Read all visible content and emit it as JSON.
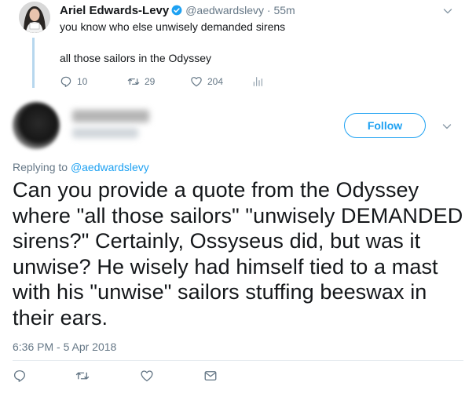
{
  "parent_tweet": {
    "author_name": "Ariel Edwards-Levy",
    "handle_time": "@aedwardslevy · 55m",
    "line1": "you know who else unwisely demanded sirens",
    "line2": "all those sailors in the Odyssey",
    "replies": "10",
    "retweets": "29",
    "likes": "204",
    "icons": [
      "reply-icon",
      "retweet-icon",
      "like-icon",
      "analytics-icon",
      "verified-badge-icon",
      "chevron-down-icon"
    ]
  },
  "reply_tweet": {
    "follow_label": "Follow",
    "replying_prefix": "Replying to ",
    "replying_handle": "@aedwardslevy",
    "text": "Can you provide a quote from the Odyssey where \"all those sailors\" \"unwisely DEMANDED sirens?\" Certainly, Ossyseus did, but was it unwise? He wisely had himself tied to a mast with his \"unwise\" sailors stuffing beeswax in their ears.",
    "timestamp": "6:36 PM - 5 Apr 2018",
    "icons": [
      "reply-icon",
      "retweet-icon",
      "like-icon",
      "message-icon",
      "chevron-down-icon"
    ]
  },
  "colors": {
    "accent": "#1da1f2",
    "secondary_text": "#657786",
    "thread_line": "#b7d7ee",
    "divider": "#e6ecf0"
  }
}
